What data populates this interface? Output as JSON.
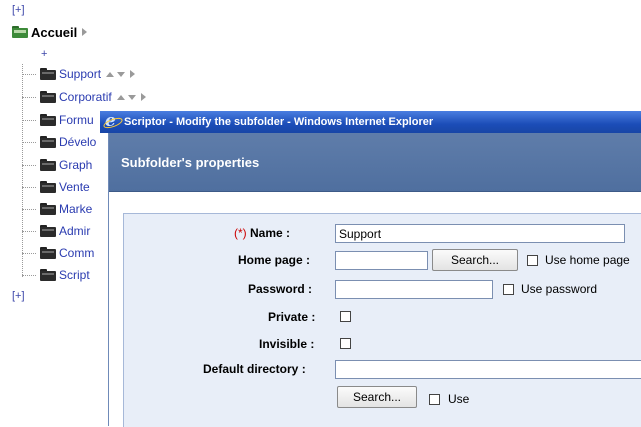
{
  "tree": {
    "expand_top": "[+]",
    "expand_bottom": "[+]",
    "root_label": "Accueil",
    "add_symbol": "+",
    "items": [
      {
        "label": "Support"
      },
      {
        "label": "Corporatif"
      },
      {
        "label": "Formu"
      },
      {
        "label": "Dévelo"
      },
      {
        "label": "Graph"
      },
      {
        "label": "Vente"
      },
      {
        "label": "Marke"
      },
      {
        "label": "Admir"
      },
      {
        "label": "Comm"
      },
      {
        "label": "Script"
      }
    ]
  },
  "dialog": {
    "window_title": "Scriptor - Modify the subfolder - Windows Internet Explorer",
    "header_title": "Subfolder's properties",
    "form": {
      "name_required_mark": "(*)",
      "name_label": "Name :",
      "name_value": "Support",
      "home_page_label": "Home page :",
      "home_page_value": "",
      "home_search_button": "Search...",
      "use_home_page_label": "Use home page",
      "password_label": "Password :",
      "password_value": "",
      "use_password_label": "Use password",
      "private_label": "Private :",
      "invisible_label": "Invisible :",
      "default_directory_label": "Default directory :",
      "default_directory_value": "",
      "dir_search_button": "Search...",
      "use_label": "Use"
    }
  },
  "colors": {
    "titlebar": "#1c4db8",
    "header_band": "#5a78a6",
    "content_bg": "#e8eef8",
    "link": "#2a3bb0"
  },
  "icons": {
    "root": "green-folder-icon",
    "item": "folder-icon",
    "browser": "ie-icon"
  }
}
